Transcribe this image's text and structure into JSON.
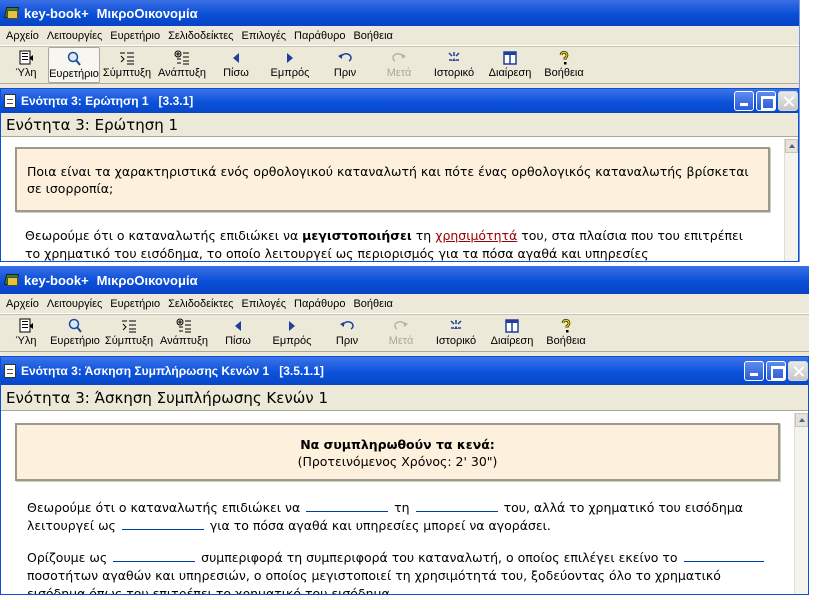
{
  "windows": [
    {
      "app_name": "key-book+",
      "book": "ΜικροΟικονομία",
      "menu": [
        "Αρχείο",
        "Λειτουργίες",
        "Ευρετήριο",
        "Σελιδοδείκτες",
        "Επιλογές",
        "Παράθυρο",
        "Βοήθεια"
      ],
      "toolbar": [
        {
          "label": "Ύλη",
          "icon": "toc-icon"
        },
        {
          "label": "Ευρετήριο",
          "icon": "search-icon"
        },
        {
          "label": "Σύμπτυξη",
          "icon": "collapse-icon"
        },
        {
          "label": "Ανάπτυξη",
          "icon": "expand-icon"
        },
        {
          "label": "Πίσω",
          "icon": "back-arrow-icon"
        },
        {
          "label": "Εμπρός",
          "icon": "forward-arrow-icon"
        },
        {
          "label": "Πριν",
          "icon": "undo-icon"
        },
        {
          "label": "Μετά",
          "icon": "redo-icon"
        },
        {
          "label": "Ιστορικό",
          "icon": "history-icon"
        },
        {
          "label": "Διαίρεση",
          "icon": "split-icon"
        },
        {
          "label": "Βοήθεια",
          "icon": "help-icon"
        }
      ],
      "doc_title": "Ενότητα 3: Ερώτηση 1   [3.3.1]",
      "heading": "Ενότητα 3: Ερώτηση 1",
      "question": "Ποια είναι τα χαρακτηριστικά ενός ορθολογικού καταναλωτή και πότε ένας ορθολογικός καταναλωτής βρίσκεται σε ισορροπία;",
      "para_a": "Θεωρούμε ότι ο καταναλωτής επιδιώκει να ",
      "para_bold": "μεγιστοποιήσει",
      "para_b": " τη ",
      "para_link": "χρησιμότητά",
      "para_c": " του, στα πλαίσια που του επιτρέπει το χρηματικό του εισόδημα, το οποίο λειτουργεί ως περιορισμός για τα πόσα αγαθά και υπηρεσίες"
    },
    {
      "app_name": "key-book+",
      "book": "ΜικροΟικονομία",
      "menu": [
        "Αρχείο",
        "Λειτουργίες",
        "Ευρετήριο",
        "Σελιδοδείκτες",
        "Επιλογές",
        "Παράθυρο",
        "Βοήθεια"
      ],
      "doc_title": "Ενότητα 3: Άσκηση Συμπλήρωσης Κενών 1   [3.5.1.1]",
      "heading": "Ενότητα 3: Άσκηση Συμπλήρωσης Κενών 1",
      "box_title": "Να συμπληρωθούν τα κενά:",
      "box_sub": "(Προτεινόμενος Χρόνος: 2' 30\")",
      "p1_a": "Θεωρούμε ότι ο καταναλωτής επιδιώκει να",
      "p1_b": "τη",
      "p1_c": "του, αλλά το χρηματικό του εισόδημα λειτουργεί ως",
      "p1_d": "για το πόσα αγαθά και υπηρεσίες μπορεί να αγοράσει.",
      "p2_a": "Ορίζουμε ως",
      "p2_b": "συμπεριφορά τη συμπεριφορά του καταναλωτή, ο οποίος επιλέγει εκείνο το",
      "p2_c": "ποσοτήτων αγαθών και υπηρεσιών, ο οποίος μεγιστοποιεί τη χρησιμότητά του, ξοδεύοντας",
      "p2_d": "όλο το χρηματικό εισόδημα όπως του επιτρέπει το χρηματικό του εισόδημα."
    }
  ]
}
